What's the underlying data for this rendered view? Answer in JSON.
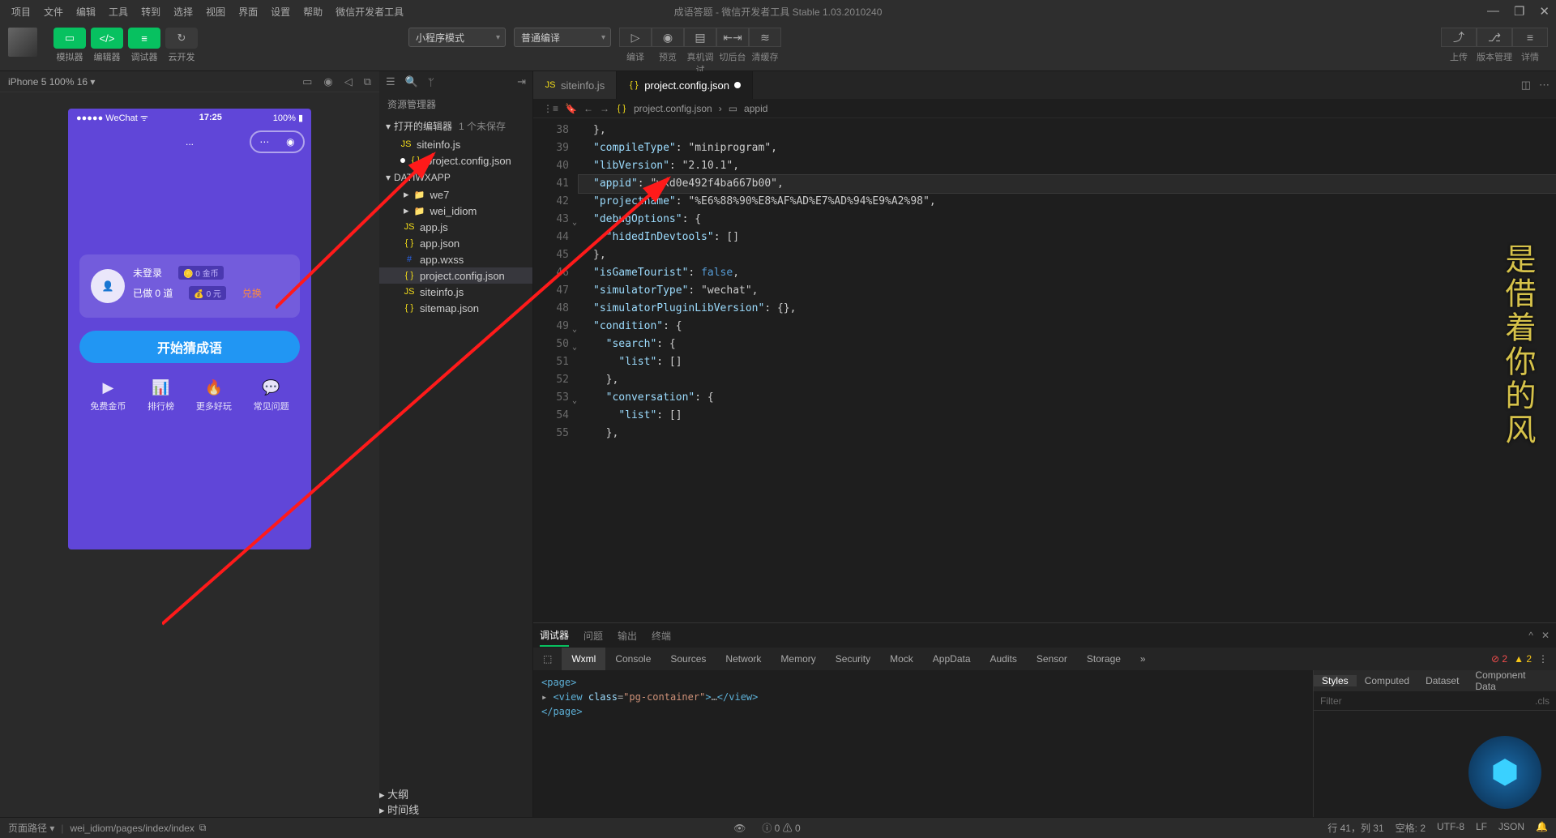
{
  "titlebar": {
    "menus": [
      "项目",
      "文件",
      "编辑",
      "工具",
      "转到",
      "选择",
      "视图",
      "界面",
      "设置",
      "帮助",
      "微信开发者工具"
    ],
    "title": "成语答题 - 微信开发者工具 Stable 1.03.2010240"
  },
  "toolbar": {
    "modeButtons": [
      {
        "label": "模拟器"
      },
      {
        "label": "编辑器"
      },
      {
        "label": "调试器"
      },
      {
        "label": "云开发"
      }
    ],
    "dropdown1": "小程序模式",
    "dropdown2": "普通编译",
    "centerIcons": [
      {
        "label": "编译"
      },
      {
        "label": "预览"
      },
      {
        "label": "真机调试"
      },
      {
        "label": "切后台"
      },
      {
        "label": "清缓存"
      }
    ],
    "rightIcons": [
      {
        "label": "上传"
      },
      {
        "label": "版本管理"
      },
      {
        "label": "详情"
      }
    ]
  },
  "simHeader": {
    "device": "iPhone 5 100% 16 ▾"
  },
  "phone": {
    "carrier": "●●●●● WeChat",
    "time": "17:25",
    "battery": "100%",
    "navDots": "...",
    "notLogged": "未登录",
    "done": "已做 0 道",
    "coin": "0 金币",
    "yuan": "0 元",
    "exchange": "兑换",
    "bigButton": "开始猜成语",
    "gridItems": [
      {
        "label": "免费金币"
      },
      {
        "label": "排行榜"
      },
      {
        "label": "更多好玩"
      },
      {
        "label": "常见问题"
      }
    ]
  },
  "explorer": {
    "title": "资源管理器",
    "openEditors": "打开的编辑器",
    "unsaved": "1 个未保存",
    "openFiles": [
      {
        "name": "siteinfo.js",
        "icon": "js"
      },
      {
        "name": "project.config.json",
        "icon": "json",
        "modified": true
      }
    ],
    "root": "DATIWXAPP",
    "tree": [
      {
        "name": "we7",
        "icon": "folder",
        "indent": 1
      },
      {
        "name": "wei_idiom",
        "icon": "folder",
        "indent": 1
      },
      {
        "name": "app.js",
        "icon": "js",
        "indent": 1
      },
      {
        "name": "app.json",
        "icon": "json",
        "indent": 1
      },
      {
        "name": "app.wxss",
        "icon": "css",
        "indent": 1
      },
      {
        "name": "project.config.json",
        "icon": "json",
        "indent": 1,
        "selected": true
      },
      {
        "name": "siteinfo.js",
        "icon": "js",
        "indent": 1
      },
      {
        "name": "sitemap.json",
        "icon": "json",
        "indent": 1
      }
    ],
    "outline": "大纲",
    "timeline": "时间线"
  },
  "tabs": [
    {
      "name": "siteinfo.js",
      "icon": "js"
    },
    {
      "name": "project.config.json",
      "icon": "json",
      "active": true,
      "modified": true
    }
  ],
  "breadcrumb": {
    "file": "project.config.json",
    "symbol": "appid"
  },
  "code": {
    "startLine": 38,
    "lines": [
      {
        "n": 38,
        "t": "},"
      },
      {
        "n": 39,
        "t": "\"compileType\": \"miniprogram\","
      },
      {
        "n": 40,
        "t": "\"libVersion\": \"2.10.1\","
      },
      {
        "n": 41,
        "t": "\"appid\": \"wxd0e492f4ba667b00\",",
        "hl": true,
        "red": "wxd0e492f4ba667b00"
      },
      {
        "n": 42,
        "t": "\"projectname\": \"%E6%88%90%E8%AF%AD%E7%AD%94%E9%A2%98\",",
        "red": "%E6%88%90%E8%AF%AD%E7%AD%94%E9%A2%98"
      },
      {
        "n": 43,
        "t": "\"debugOptions\": {",
        "fold": "v"
      },
      {
        "n": 44,
        "t": "  \"hidedInDevtools\": []"
      },
      {
        "n": 45,
        "t": "},"
      },
      {
        "n": 46,
        "t": "\"isGameTourist\": false,"
      },
      {
        "n": 47,
        "t": "\"simulatorType\": \"wechat\","
      },
      {
        "n": 48,
        "t": "\"simulatorPluginLibVersion\": {},"
      },
      {
        "n": 49,
        "t": "\"condition\": {",
        "fold": "v"
      },
      {
        "n": 50,
        "t": "  \"search\": {",
        "fold": "v"
      },
      {
        "n": 51,
        "t": "    \"list\": []"
      },
      {
        "n": 52,
        "t": "  },"
      },
      {
        "n": 53,
        "t": "  \"conversation\": {",
        "fold": "v"
      },
      {
        "n": 54,
        "t": "    \"list\": []"
      },
      {
        "n": 55,
        "t": "  },"
      }
    ]
  },
  "bottomPanel": {
    "tabs": [
      "调试器",
      "问题",
      "输出",
      "终端"
    ],
    "activeTab": "调试器",
    "devTabs": [
      "Wxml",
      "Console",
      "Sources",
      "Network",
      "Memory",
      "Security",
      "Mock",
      "AppData",
      "Audits",
      "Sensor",
      "Storage"
    ],
    "activeDevTab": "Wxml",
    "errors": 2,
    "warnings": 2,
    "rightTabs": [
      "Styles",
      "Computed",
      "Dataset",
      "Component Data"
    ],
    "filter": "Filter",
    "cls": ".cls",
    "wxml": {
      "l1": "<page>",
      "l2": "▸ <view class=\"pg-container\">…</view>",
      "l3": "</page>"
    }
  },
  "statusbar": {
    "left1": "页面路径 ▾",
    "left2": "wei_idiom/pages/index/index",
    "info": "ⓘ 0 ⚠ 0",
    "pos": "行 41，列 31",
    "spaces": "空格: 2",
    "enc": "UTF-8",
    "eol": "LF",
    "lang": "JSON"
  },
  "watermark": "是借着你的风"
}
